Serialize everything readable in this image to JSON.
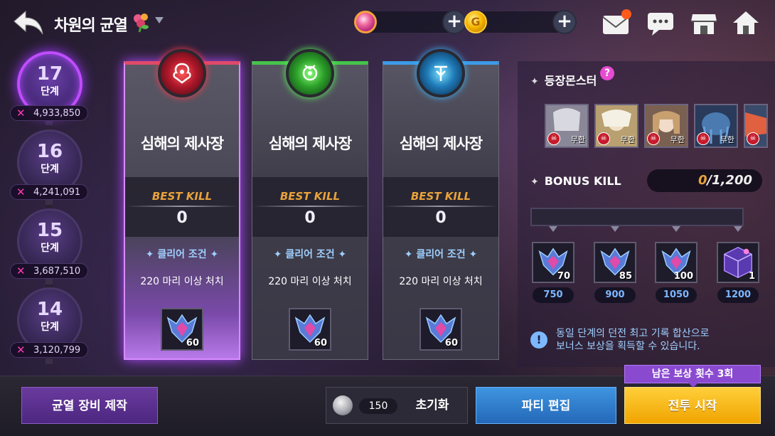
{
  "header": {
    "title": "차원의 균열",
    "title_icon": "flower-icon",
    "currencies": [
      {
        "name": "gem",
        "icon": "gem-icon"
      },
      {
        "name": "gold",
        "icon": "gold-coin-icon",
        "symbol": "G"
      }
    ],
    "plus_label": "+"
  },
  "stages": [
    {
      "number": "17",
      "unit": "단계",
      "score": "4,933,850",
      "active": true
    },
    {
      "number": "16",
      "unit": "단계",
      "score": "4,241,091",
      "active": false
    },
    {
      "number": "15",
      "unit": "단계",
      "score": "3,687,510",
      "active": false
    },
    {
      "number": "14",
      "unit": "단계",
      "score": "3,120,799",
      "active": false
    }
  ],
  "score_marker": "✕",
  "dungeons": [
    {
      "name": "심해의 제사장",
      "best_label": "BEST KILL",
      "best_value": "0",
      "clear_title": "✦ 클리어 조건 ✦",
      "clear_condition": "220 마리 이상 처치",
      "reward_qty": "60",
      "color": "#d23f5a"
    },
    {
      "name": "심해의 제사장",
      "best_label": "BEST KILL",
      "best_value": "0",
      "clear_title": "✦ 클리어 조건 ✦",
      "clear_condition": "220 마리 이상 처치",
      "reward_qty": "60",
      "color": "#46c44a"
    },
    {
      "name": "심해의 제사장",
      "best_label": "BEST KILL",
      "best_value": "0",
      "clear_title": "✦ 클리어 조건 ✦",
      "clear_condition": "220 마리 이상 처치",
      "reward_qty": "60",
      "color": "#3c9ae6"
    }
  ],
  "monsters_panel": {
    "title": "등장몬스터",
    "help": "?",
    "monsters": [
      {
        "tag": "무한"
      },
      {
        "tag": "무한"
      },
      {
        "tag": "무한"
      },
      {
        "tag": "무한"
      },
      {
        "tag": ""
      }
    ]
  },
  "bonus": {
    "title": "BONUS KILL",
    "current": "0",
    "max": "/1,200",
    "progress": 0,
    "rewards": [
      {
        "qty": "70",
        "threshold": "750"
      },
      {
        "qty": "85",
        "threshold": "900"
      },
      {
        "qty": "100",
        "threshold": "1050"
      },
      {
        "qty": "1",
        "threshold": "1200"
      }
    ]
  },
  "info": {
    "icon": "!",
    "line1": "동일 단계의 던전 최고 기록 합산으로",
    "line2": "보너스 보상을 획득할 수 있습니다."
  },
  "bottom": {
    "craft_label": "균열 장비 제작",
    "reset_count": "150",
    "reset_label": "초기화",
    "party_label": "파티 편집",
    "battle_label": "전투 시작",
    "remain_label": "남은 보상 횟수 3회"
  }
}
